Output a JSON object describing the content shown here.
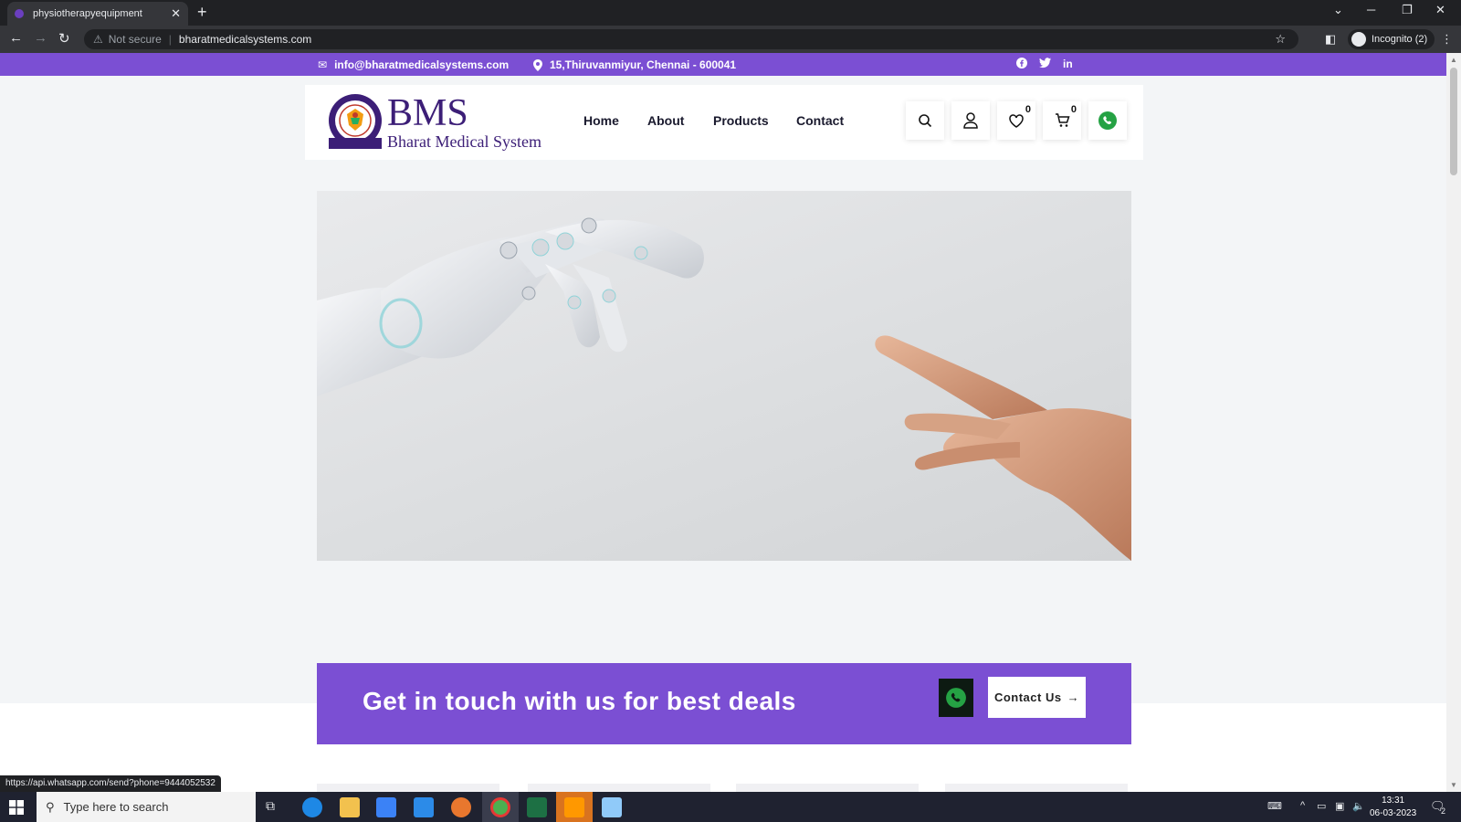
{
  "browser": {
    "tab_title": "physiotherapyequipment",
    "tab_close": "✕",
    "new_tab": "+",
    "security_label": "Not secure",
    "url": "bharatmedicalsystems.com",
    "profile_label": "Incognito (2)",
    "status_url": "https://api.whatsapp.com/send?phone=9444052532"
  },
  "topbar": {
    "email": "info@bharatmedicalsystems.com",
    "address": "15,Thiruvanmiyur, Chennai - 600041",
    "social": [
      "facebook-icon",
      "twitter-icon",
      "linkedin-icon"
    ]
  },
  "header": {
    "logo_title": "BMS",
    "logo_subtitle": "Bharat Medical System",
    "nav": [
      "Home",
      "About",
      "Products",
      "Contact"
    ],
    "wishlist_count": "0",
    "cart_count": "0"
  },
  "cta": {
    "headline": "Get in touch with us for best deals",
    "button_label": "Contact Us"
  },
  "taskbar": {
    "search_placeholder": "Type here to search",
    "time": "13:31",
    "date": "06-03-2023",
    "notification_count": "2"
  },
  "colors": {
    "brand_purple": "#7b4fd3",
    "logo_navy": "#3c1e77",
    "whatsapp_green": "#25a244"
  }
}
